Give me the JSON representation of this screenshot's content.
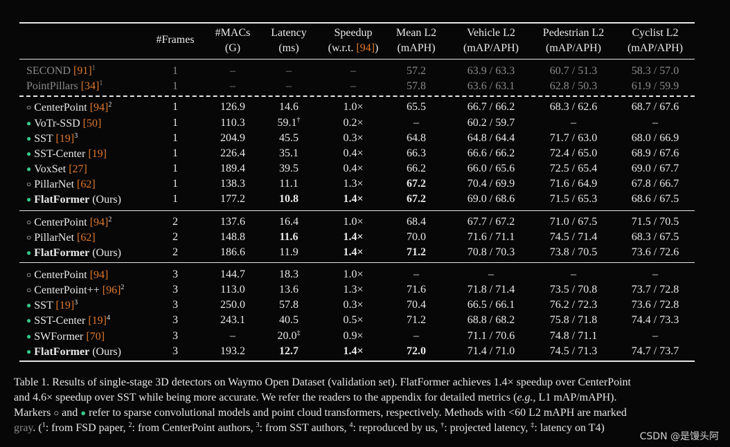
{
  "columns": [
    {
      "l1": "#Frames",
      "l2": ""
    },
    {
      "l1": "#MACs",
      "l2": "(G)"
    },
    {
      "l1": "Latency",
      "l2": "(ms)"
    },
    {
      "l1": "Speedup",
      "l2": "(w.r.t. ",
      "ref": "[94]",
      "tail": ")"
    },
    {
      "l1": "Mean L2",
      "l2": "(mAPH)"
    },
    {
      "l1": "Vehicle L2",
      "l2": "(mAP/APH)"
    },
    {
      "l1": "Pedestrian L2",
      "l2": "(mAP/APH)"
    },
    {
      "l1": "Cyclist L2",
      "l2": "(mAP/APH)"
    }
  ],
  "rows": [
    {
      "name": "SECOND",
      "ref": "[91]",
      "sup": "1",
      "marker": "",
      "gray": true,
      "cells": [
        "1",
        "–",
        "–",
        "–",
        "57.2",
        "63.9 / 63.3",
        "60.7 / 51.3",
        "58.3 / 57.0"
      ],
      "bold": []
    },
    {
      "name": "PointPillars",
      "ref": "[34]",
      "sup": "1",
      "marker": "",
      "gray": true,
      "cells": [
        "1",
        "–",
        "–",
        "–",
        "57.8",
        "63.6 / 63.1",
        "62.8 / 50.3",
        "61.9 / 59.9"
      ],
      "bold": []
    },
    {
      "name": "CenterPoint",
      "ref": "[94]",
      "sup": "2",
      "marker": "circle",
      "cells": [
        "1",
        "126.9",
        "14.6",
        "1.0×",
        "65.5",
        "66.7 / 66.2",
        "68.3 / 62.6",
        "68.7 / 67.6"
      ],
      "bold": []
    },
    {
      "name": "VoTr-SSD",
      "ref": "[50]",
      "sup": "",
      "marker": "dot",
      "cells": [
        "1",
        "110.3",
        "59.1†",
        "0.2×",
        "–",
        "60.2 / 59.7",
        "–",
        "–"
      ],
      "bold": []
    },
    {
      "name": "SST",
      "ref": "[19]",
      "sup": "3",
      "marker": "dot",
      "cells": [
        "1",
        "204.9",
        "45.5",
        "0.3×",
        "64.8",
        "64.8 / 64.4",
        "71.7 / 63.0",
        "68.0 / 66.9"
      ],
      "bold": []
    },
    {
      "name": "SST-Center",
      "ref": "[19]",
      "sup": "",
      "marker": "dot",
      "cells": [
        "1",
        "226.4",
        "35.1",
        "0.4×",
        "66.3",
        "66.6 / 66.2",
        "72.4 / 65.0",
        "68.9 / 67.6"
      ],
      "bold": []
    },
    {
      "name": "VoxSet",
      "ref": "[27]",
      "sup": "",
      "marker": "dot",
      "cells": [
        "1",
        "189.4",
        "39.5",
        "0.4×",
        "66.2",
        "66.0 / 65.6",
        "72.5 / 65.4",
        "69.0 / 67.7"
      ],
      "bold": []
    },
    {
      "name": "PillarNet",
      "ref": "[62]",
      "sup": "",
      "marker": "circle",
      "cells": [
        "1",
        "138.3",
        "11.1",
        "1.3×",
        "67.2",
        "70.4 / 69.9",
        "71.6 / 64.9",
        "67.8 / 66.7"
      ],
      "bold": [
        4
      ]
    },
    {
      "name": "FlatFormer",
      "suffix": " (Ours)",
      "ref": "",
      "sup": "",
      "marker": "dot",
      "boldname": true,
      "cells": [
        "1",
        "177.2",
        "10.8",
        "1.4×",
        "67.2",
        "69.0 / 68.6",
        "71.5 / 65.3",
        "68.6 / 67.5"
      ],
      "bold": [
        2,
        3,
        4
      ]
    },
    {
      "name": "CenterPoint",
      "ref": "[94]",
      "sup": "2",
      "marker": "circle",
      "cells": [
        "2",
        "137.6",
        "16.4",
        "1.0×",
        "68.4",
        "67.7 / 67.2",
        "71.0 / 67.5",
        "71.5 / 70.5"
      ],
      "bold": []
    },
    {
      "name": "PillarNet",
      "ref": "[62]",
      "sup": "",
      "marker": "circle",
      "cells": [
        "2",
        "148.8",
        "11.6",
        "1.4×",
        "70.0",
        "71.6 / 71.1",
        "74.5 / 71.4",
        "68.3 / 67.5"
      ],
      "bold": [
        2,
        3
      ]
    },
    {
      "name": "FlatFormer",
      "suffix": " (Ours)",
      "ref": "",
      "sup": "",
      "marker": "dot",
      "boldname": true,
      "cells": [
        "2",
        "186.6",
        "11.9",
        "1.4×",
        "71.2",
        "70.8 / 70.3",
        "73.8 / 70.5",
        "73.6 / 72.6"
      ],
      "bold": [
        3,
        4
      ]
    },
    {
      "name": "CenterPoint",
      "ref": "[94]",
      "sup": "",
      "marker": "circle",
      "cells": [
        "3",
        "144.7",
        "18.3",
        "1.0×",
        "–",
        "–",
        "–",
        "–"
      ],
      "bold": []
    },
    {
      "name": "CenterPoint++",
      "ref": "[96]",
      "sup": "2",
      "marker": "circle",
      "cells": [
        "3",
        "113.0",
        "13.6",
        "1.3×",
        "71.6",
        "71.8 / 71.4",
        "73.5 / 70.8",
        "73.7 / 72.8"
      ],
      "bold": []
    },
    {
      "name": "SST",
      "ref": "[19]",
      "sup": "3",
      "marker": "dot",
      "cells": [
        "3",
        "250.0",
        "57.8",
        "0.3×",
        "70.4",
        "66.5 / 66.1",
        "76.2 / 72.3",
        "73.6 / 72.8"
      ],
      "bold": []
    },
    {
      "name": "SST-Center",
      "ref": "[19]",
      "sup": "4",
      "marker": "dot",
      "cells": [
        "3",
        "243.1",
        "40.5",
        "0.5×",
        "71.2",
        "68.8 / 68.2",
        "75.8 / 71.8",
        "74.4 / 73.3"
      ],
      "bold": []
    },
    {
      "name": "SWFormer",
      "ref": "[70]",
      "sup": "",
      "marker": "dot",
      "cells": [
        "3",
        "–",
        "20.0‡",
        "0.9×",
        "–",
        "71.1 / 70.6",
        "74.8 / 71.1",
        "–"
      ],
      "bold": []
    },
    {
      "name": "FlatFormer",
      "suffix": " (Ours)",
      "ref": "",
      "sup": "",
      "marker": "dot",
      "boldname": true,
      "cells": [
        "3",
        "193.2",
        "12.7",
        "1.4×",
        "72.0",
        "71.4 / 71.0",
        "74.5 / 71.3",
        "74.7 / 73.7"
      ],
      "bold": [
        2,
        3,
        4
      ]
    }
  ],
  "caption": {
    "line1": "Table 1. Results of single-stage 3D detectors on Waymo Open Dataset (validation set). FlatFormer achieves 1.4× speedup over CenterPoint",
    "line2a": "and 4.6× speedup over SST while being more accurate. We refer the readers to the appendix for detailed metrics (",
    "line2b": "e.g.",
    "line2c": ", L1 mAP/mAPH).",
    "line3a": "Markers ",
    "line3b": "○",
    "line3c": " and ",
    "line3d": "●",
    "line3e": " refer to sparse convolutional models and point cloud transformers, respectively. Methods with <60 L2 mAPH are marked",
    "line4a": "gray",
    "line4b": ". (",
    "line4c": ": from FSD paper, ",
    "line4d": ": from CenterPoint authors, ",
    "line4e": ": from SST authors, ",
    "line4f": ": reproduced by us, ",
    "line4g": ": projected latency, ",
    "line4h": ": latency on T4)",
    "s1": "1",
    "s2": "2",
    "s3": "3",
    "s4": "4",
    "s5": "†",
    "s6": "‡"
  },
  "watermark": "CSDN @是馒头阿",
  "colors": {
    "ref": "#e0782c",
    "dot": "#36c98a",
    "gray": "#8a8a8a"
  }
}
